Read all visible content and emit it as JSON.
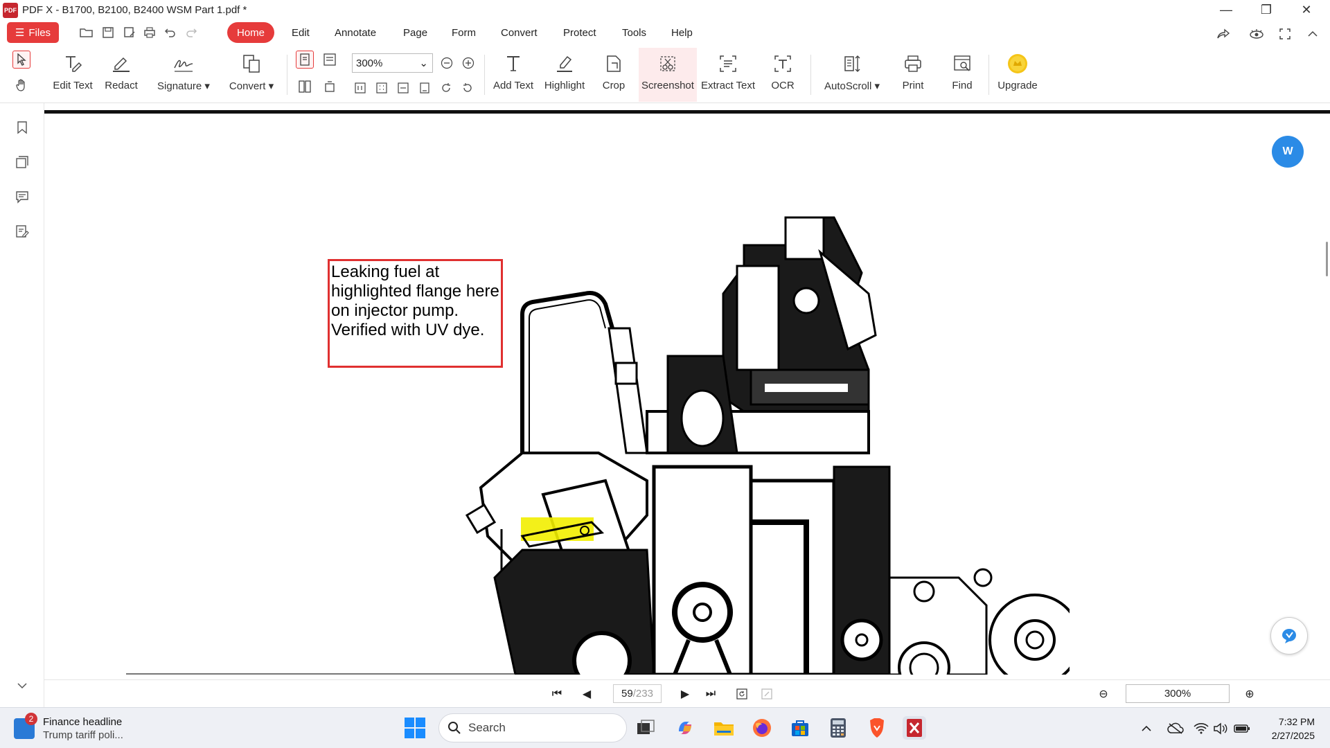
{
  "titlebar": {
    "app_logo": "PDF",
    "title": "PDF X - B1700, B2100, B2400 WSM Part 1.pdf *",
    "minimize": "—",
    "restore": "❐",
    "close": "✕"
  },
  "menubar": {
    "files_label": "Files",
    "items": [
      "Home",
      "Edit",
      "Annotate",
      "Page",
      "Form",
      "Convert",
      "Protect",
      "Tools",
      "Help"
    ],
    "active": "Home"
  },
  "toolbar": {
    "edit_text": "Edit Text",
    "redact": "Redact",
    "signature": "Signature ▾",
    "convert": "Convert ▾",
    "zoom_value": "300%",
    "zoom_arrow": "⌄",
    "add_text": "Add Text",
    "highlight": "Highlight",
    "crop": "Crop",
    "screenshot": "Screenshot",
    "extract_text": "Extract Text",
    "ocr": "OCR",
    "autoscroll": "AutoScroll ▾",
    "print": "Print",
    "find": "Find",
    "upgrade": "Upgrade",
    "accent_color": "#e63b3b"
  },
  "document": {
    "annotation_text": "Leaking fuel at highlighted flange here on injector pump. Verified with UV dye.",
    "annotation_border_color": "#e03030",
    "highlight_color": "#f2ee00",
    "word_fab_label": "W"
  },
  "navigation": {
    "first": "⏮",
    "prev": "◀",
    "current_page": "59",
    "total_pages": "/233",
    "next": "▶",
    "last": "⏭",
    "zoom_value": "300%",
    "zoom_out": "⊖",
    "zoom_in": "⊕"
  },
  "taskbar": {
    "news_badge": "2",
    "news_headline": "Finance headline",
    "news_subtitle": "Trump tariff poli...",
    "search_placeholder": "Search",
    "time": "7:32 PM",
    "date": "2/27/2025"
  }
}
